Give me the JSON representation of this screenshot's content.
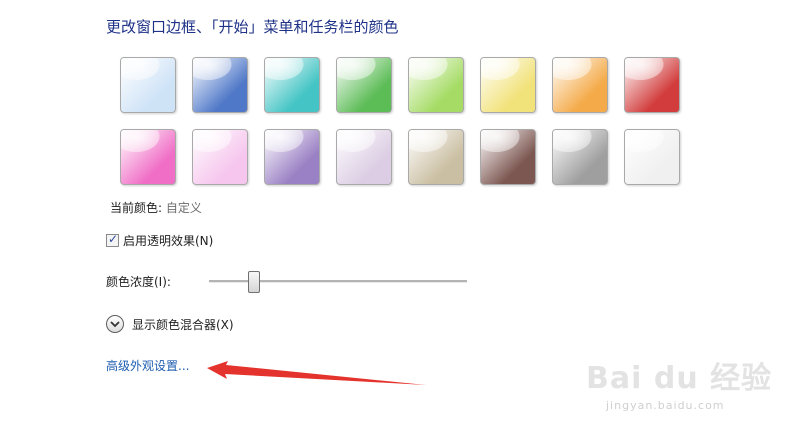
{
  "title": "更改窗口边框、「开始」菜单和任务栏的颜色",
  "swatches": [
    {
      "name": "sky",
      "color": "#cfe3f7"
    },
    {
      "name": "twilight",
      "color": "#4f78c8"
    },
    {
      "name": "sea",
      "color": "#44c4c4"
    },
    {
      "name": "leaf",
      "color": "#5cbc56"
    },
    {
      "name": "lime",
      "color": "#a6dc66"
    },
    {
      "name": "lemon",
      "color": "#f2e27a"
    },
    {
      "name": "pumpkin",
      "color": "#f4aa48"
    },
    {
      "name": "ruby",
      "color": "#d23c3c"
    },
    {
      "name": "fuchsia",
      "color": "#f06ec6"
    },
    {
      "name": "blush",
      "color": "#f6c6ee"
    },
    {
      "name": "violet",
      "color": "#9a80c4"
    },
    {
      "name": "lavender",
      "color": "#dccde4"
    },
    {
      "name": "taupe",
      "color": "#cbbfa3"
    },
    {
      "name": "chocolate",
      "color": "#7c5650"
    },
    {
      "name": "slate",
      "color": "#9f9f9f"
    },
    {
      "name": "frost",
      "color": "#f0f0f0"
    }
  ],
  "current_color": {
    "label": "当前颜色: ",
    "value": "自定义"
  },
  "transparency": {
    "label": "启用透明效果(N)",
    "checked": true
  },
  "intensity": {
    "label": "颜色浓度(I):",
    "value_fraction": 0.17
  },
  "mixer": {
    "label": "显示颜色混合器(X)"
  },
  "advanced_link": "高级外观设置...",
  "watermark": {
    "text": "Bai du 经验",
    "url": "jingyan.baidu.com"
  },
  "colors": {
    "title": "#1e3287",
    "link": "#1d5db0",
    "arrow": "#e4332c"
  }
}
